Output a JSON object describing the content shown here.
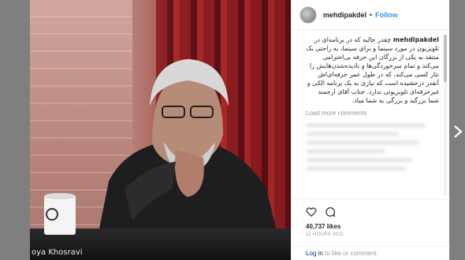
{
  "photo": {
    "caption": "oya Khosravi"
  },
  "post": {
    "username": "mehdipakdel",
    "dot": "•",
    "follow_label": "Follow",
    "caption_username": "mehdipakdel",
    "caption_body": "چقدر جالبه که در برنامه‌ای در تلویزیون در مورد سینما و برای سینما، به راحتی یک منتقد به یکی از بزرگان این حرفه بی‌احترامی می‌کند و تمام سرخوردگی‌ها و نادیده‌شدن‌هایش را نثار کسی می‌کند، که در طول عمر حرفه‌ای‌اش آنقدر درخشیده است که نیازی به یک برنامه الکی و غیرحرفه‌ای تلویزیونی ندارد. جناب آقای ارجمند شما بزرگید و بزرگی به شما میاد.",
    "load_more": "Load more comments",
    "likes": "40,737 likes",
    "time": "11 HOURS AGO"
  },
  "footer": {
    "login_link": "Log in",
    "rest": " to like or comment."
  },
  "icons": {
    "like": "heart-icon",
    "comment": "comment-icon",
    "next": "chevron-right-icon"
  },
  "colors": {
    "accent": "#3897f0",
    "link": "#003569",
    "muted": "#999999",
    "text": "#262626"
  }
}
